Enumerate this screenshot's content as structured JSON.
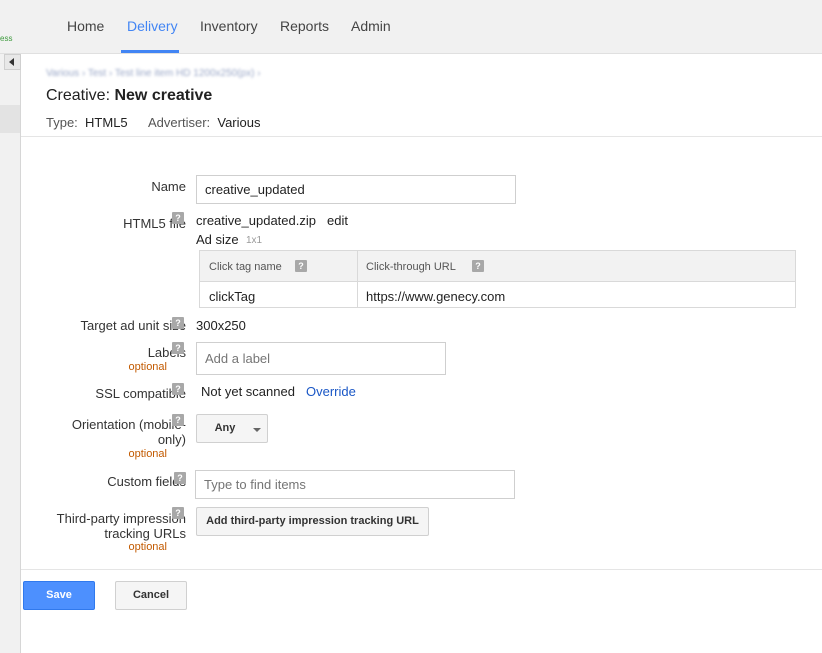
{
  "nav": {
    "home": "Home",
    "delivery": "Delivery",
    "inventory": "Inventory",
    "reports": "Reports",
    "admin": "Admin",
    "side_fragment": "ess"
  },
  "header": {
    "breadcrumb": "Various  ›  Test  ›  Test line item HD 1200x250(px)  ›",
    "title_prefix": "Creative: ",
    "title_name": "New creative",
    "type_label": "Type:",
    "type_value": "HTML5",
    "advertiser_label": "Advertiser:",
    "advertiser_value": "Various"
  },
  "form": {
    "name": {
      "label": "Name",
      "value": "creative_updated"
    },
    "html5_file": {
      "label": "HTML5 file",
      "file_name": "creative_updated.zip",
      "edit_link": "edit",
      "ad_size_label": "Ad size",
      "ad_size_value": "1x1"
    },
    "click_tags": {
      "columns": [
        "Click tag name",
        "Click-through URL"
      ],
      "rows": [
        {
          "name": "clickTag",
          "url": "https://www.genecy.com"
        }
      ]
    },
    "target_ad_unit_size": {
      "label": "Target ad unit size",
      "value": "300x250"
    },
    "labels": {
      "label": "Labels",
      "optional": "optional",
      "placeholder": "Add a label"
    },
    "ssl": {
      "label": "SSL compatible",
      "status": "Not yet scanned",
      "override_link": "Override"
    },
    "orientation": {
      "label_line1": "Orientation (mobile-",
      "label_line2": "only)",
      "optional": "optional",
      "value": "Any"
    },
    "custom_fields": {
      "label": "Custom fields",
      "placeholder": "Type to find items"
    },
    "third_party": {
      "label_line1": "Third-party impression",
      "label_line2": "tracking URLs",
      "optional": "optional",
      "button": "Add third-party impression tracking URL"
    }
  },
  "footer": {
    "save": "Save",
    "cancel": "Cancel"
  },
  "colors": {
    "accent": "#4285f4",
    "primary_button": "#4d90fe",
    "optional_text": "#c25a00",
    "link": "#1a57c6"
  },
  "icons": [
    "help-icon",
    "collapse-arrow-icon",
    "dropdown-caret-icon"
  ]
}
